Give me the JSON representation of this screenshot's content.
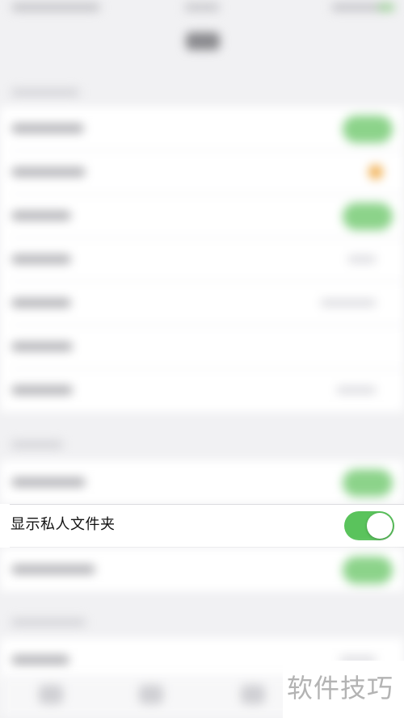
{
  "settings": {
    "highlighted_row": {
      "label": "显示私人文件夹",
      "toggle_on": true,
      "toggle_color": "#5ac35c"
    }
  },
  "watermark": {
    "text": "软件技巧"
  },
  "colors": {
    "background": "#f1f1f3",
    "cell": "#ffffff",
    "toggle_on": "#5ac35c",
    "badge": "#f1b257"
  }
}
